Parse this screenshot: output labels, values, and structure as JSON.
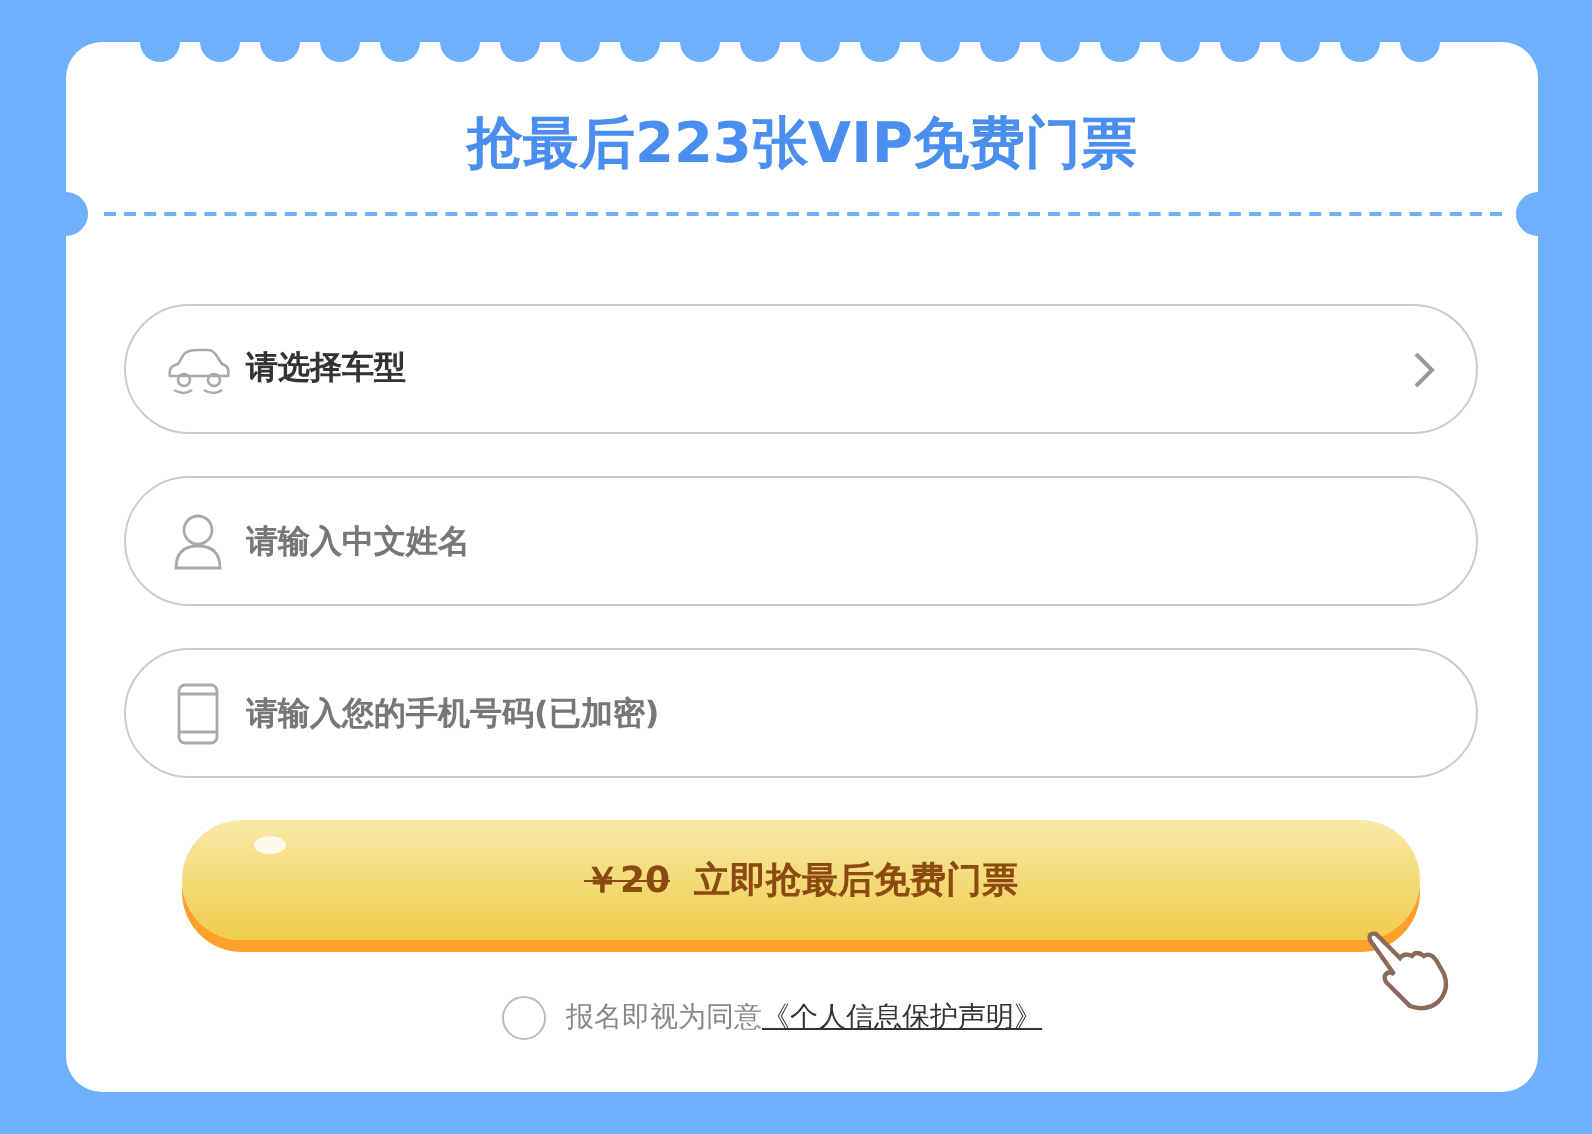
{
  "title": "抢最后223张VIP免费门票",
  "fields": [
    {
      "kind": "select",
      "placeholder": "请选择车型"
    },
    {
      "kind": "text",
      "placeholder": "请输入中文姓名"
    },
    {
      "kind": "tel",
      "placeholder": "请输入您的手机号码(已加密)"
    }
  ],
  "submit": {
    "old_price": "￥20",
    "label": "立即抢最后免费门票"
  },
  "agreement": {
    "checked": false,
    "text": "报名即视为同意",
    "link": "《个人信息保护声明》"
  }
}
